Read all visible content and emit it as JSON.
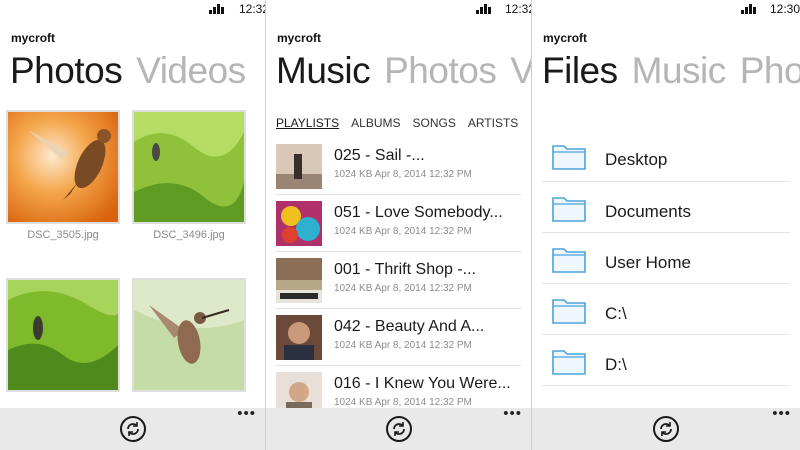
{
  "screens": [
    {
      "status": {
        "time": "12:32"
      },
      "app_name": "mycroft",
      "pivots": [
        "Photos",
        "Videos"
      ],
      "photos": [
        {
          "name": "DSC_3505.jpg"
        },
        {
          "name": "DSC_3496.jpg"
        },
        {
          "name": ""
        },
        {
          "name": ""
        }
      ]
    },
    {
      "status": {
        "time": "12:32"
      },
      "app_name": "mycroft",
      "pivots": [
        "Music",
        "Photos",
        "V"
      ],
      "subtabs": [
        "PLAYLISTS",
        "ALBUMS",
        "SONGS",
        "ARTISTS"
      ],
      "songs": [
        {
          "title": "025 - Sail -...",
          "meta": "1024 KB Apr 8, 2014 12:32 PM"
        },
        {
          "title": "051 - Love Somebody...",
          "meta": "1024 KB Apr 8, 2014 12:32 PM"
        },
        {
          "title": "001 - Thrift Shop -...",
          "meta": "1024 KB Apr 8, 2014 12:32 PM"
        },
        {
          "title": "042 - Beauty And A...",
          "meta": "1024 KB Apr 8, 2014 12:32 PM"
        },
        {
          "title": "016 - I Knew You Were...",
          "meta": "1024 KB Apr 8, 2014 12:32 PM"
        }
      ]
    },
    {
      "status": {
        "time": "12:30"
      },
      "app_name": "mycroft",
      "pivots": [
        "Files",
        "Music",
        "Pho"
      ],
      "folders": [
        "Desktop",
        "Documents",
        "User Home",
        "C:\\",
        "D:\\"
      ]
    }
  ],
  "colors": {
    "folder_stroke": "#4da3db",
    "folder_fill": "#eef7fd",
    "appbar": "#e9e9e9"
  },
  "icons": {
    "refresh": "refresh-icon",
    "more": "more-icon",
    "folder": "folder-icon",
    "battery": "battery-icon"
  }
}
